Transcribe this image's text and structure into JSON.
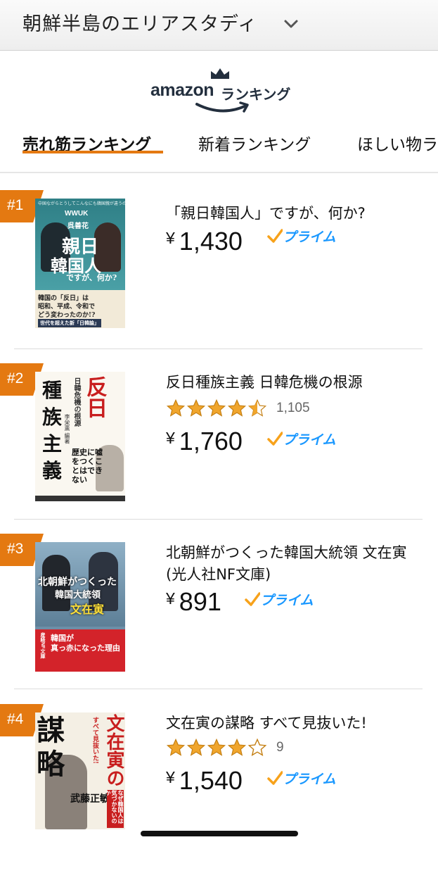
{
  "header": {
    "category_title": "朝鮮半島のエリアスタディ"
  },
  "brand": {
    "amazon": "amazon",
    "ranking": "ランキング"
  },
  "tabs": [
    {
      "label": "売れ筋ランキング",
      "active": true
    },
    {
      "label": "新着ランキング",
      "active": false
    },
    {
      "label": "ほしい物ラ",
      "active": false
    }
  ],
  "colors": {
    "accent": "#e47911",
    "prime_blue": "#1a98ff",
    "star": "#f0a52c"
  },
  "items": [
    {
      "rank": "#1",
      "title": "「親日韓国人」ですが、何か?",
      "price_currency": "¥",
      "price": "1,430",
      "prime_label": "プライム",
      "cover": {
        "top_line": "中国ながらとうしてこんなにも韓国親が違うのか",
        "author_en": "WWUK",
        "author_jp": "呉善花",
        "title_line1": "親日",
        "title_line2": "韓国人",
        "title_line3": "ですが、何か?",
        "blurb1": "韓国の「反日」は",
        "blurb2": "昭和、平成、令和で",
        "blurb3": "どう変わったのか!?",
        "tagline": "世代を超えた新「日韓論」"
      }
    },
    {
      "rank": "#2",
      "title": "反日種族主義 日韓危機の根源",
      "rating": 4.5,
      "review_count": "1,105",
      "price_currency": "¥",
      "price": "1,760",
      "prime_label": "プライム",
      "cover": {
        "red_title": "反日",
        "black_title": "種族主義",
        "subtitle": "日韓危機の根源",
        "editor": "李栄薫 編著",
        "blurb": "歴史に嘘をつくことはできない"
      }
    },
    {
      "rank": "#3",
      "title": "北朝鮮がつくった韓国大統領 文在寅 (光人社NF文庫)",
      "price_currency": "¥",
      "price": "891",
      "prime_label": "プライム",
      "cover": {
        "line1": "北朝鮮がつくった",
        "line2": "韓国大統領",
        "line3": "文在寅",
        "band1": "韓国が",
        "band2": "真っ赤になった理由",
        "series": "産経NF文庫"
      }
    },
    {
      "rank": "#4",
      "title": "文在寅の謀略 すべて見抜いた!",
      "rating": 4,
      "review_count": "9",
      "price_currency": "¥",
      "price": "1,540",
      "prime_label": "プライム",
      "cover": {
        "big": "謀略",
        "red_title": "文在寅の",
        "subtitle": "すべて見抜いた!",
        "author": "武藤正敏",
        "blurb": "なぜ韓国人は気づかないのか"
      }
    }
  ]
}
